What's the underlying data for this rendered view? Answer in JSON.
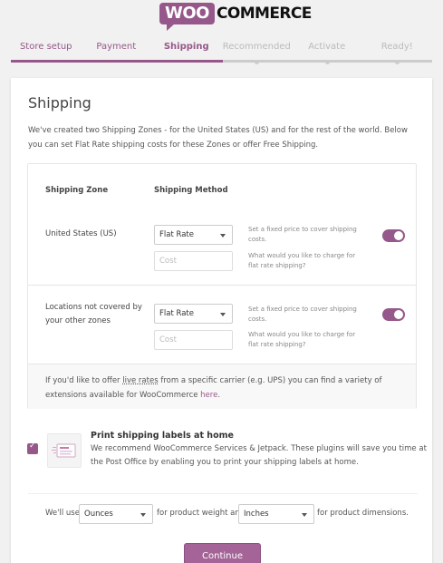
{
  "logo": {
    "bubble": "WOO",
    "text": "COMMERCE"
  },
  "steps": [
    {
      "label": "Store setup",
      "state": "done"
    },
    {
      "label": "Payment",
      "state": "done"
    },
    {
      "label": "Shipping",
      "state": "active"
    },
    {
      "label": "Recommended",
      "state": "todo"
    },
    {
      "label": "Activate",
      "state": "todo"
    },
    {
      "label": "Ready!",
      "state": "todo"
    }
  ],
  "page": {
    "title": "Shipping",
    "intro": "We've created two Shipping Zones - for the United States (US) and for the rest of the world. Below you can set Flat Rate shipping costs for these Zones or offer Free Shipping."
  },
  "zones": {
    "header_zone": "Shipping Zone",
    "header_method": "Shipping Method",
    "rows": [
      {
        "name": "United States (US)",
        "method": "Flat Rate",
        "cost_placeholder": "Cost",
        "desc1": "Set a fixed price to cover shipping costs.",
        "desc2": "What would you like to charge for flat rate shipping?",
        "enabled": true
      },
      {
        "name": "Locations not covered by your other zones",
        "method": "Flat Rate",
        "cost_placeholder": "Cost",
        "desc1": "Set a fixed price to cover shipping costs.",
        "desc2": "What would you like to charge for flat rate shipping?",
        "enabled": true
      }
    ],
    "footer": {
      "text_before": "If you'd like to offer ",
      "link_live_rates": "live rates",
      "text_middle": " from a specific carrier (e.g. UPS) you can find a variety of extensions available for WooCommerce ",
      "link_here": "here",
      "text_after": "."
    }
  },
  "labels": {
    "checked": true,
    "title": "Print shipping labels at home",
    "desc": "We recommend WooCommerce Services & Jetpack. These plugins will save you time at the Post Office by enabling you to print your shipping labels at home."
  },
  "units": {
    "prefix": "We'll use",
    "weight_value": "Ounces",
    "middle": "for product weight and",
    "dimension_value": "Inches",
    "suffix": "for product dimensions."
  },
  "continue_label": "Continue",
  "colors": {
    "accent": "#96588a",
    "button": "#a46497"
  }
}
